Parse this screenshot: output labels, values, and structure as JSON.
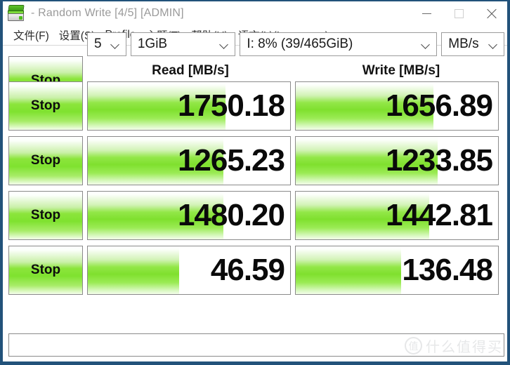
{
  "window": {
    "title": "- Random Write [4/5] [ADMIN]",
    "icon": "disk-drive-icon",
    "controls": {
      "minimize": "minimize-icon",
      "maximize": "maximize-icon",
      "close": "close-icon"
    }
  },
  "menu": {
    "items": [
      {
        "label": "文件(F)"
      },
      {
        "label": "设置(S)"
      },
      {
        "label": "Profile"
      },
      {
        "label": "主题(T)"
      },
      {
        "label": "帮助(H)"
      },
      {
        "label": "语言(L)(Language)"
      }
    ]
  },
  "toolbar": {
    "loops": "5",
    "test_size": "1GiB",
    "drive": "I: 8% (39/465GiB)",
    "unit": "MB/s"
  },
  "columns": {
    "read": "Read [MB/s]",
    "write": "Write [MB/s]"
  },
  "rows": [
    {
      "button": "Stop",
      "read_value": "1750.18",
      "read_fill_pct": 68,
      "write_value": "1656.89",
      "write_fill_pct": 68
    },
    {
      "button": "Stop",
      "read_value": "1265.23",
      "read_fill_pct": 67,
      "write_value": "1233.85",
      "write_fill_pct": 70
    },
    {
      "button": "Stop",
      "read_value": "1480.20",
      "read_fill_pct": 67,
      "write_value": "1442.81",
      "write_fill_pct": 66
    },
    {
      "button": "Stop",
      "read_value": "46.59",
      "read_fill_pct": 45,
      "write_value": "136.48",
      "write_fill_pct": 52
    }
  ],
  "statusbar": {
    "text": ""
  },
  "watermark": {
    "mark": "值",
    "text": "什么值得买"
  },
  "colors": {
    "accent_green": "#7fe02e",
    "window_border": "#22527a",
    "title_gray": "#9a9a9a"
  }
}
